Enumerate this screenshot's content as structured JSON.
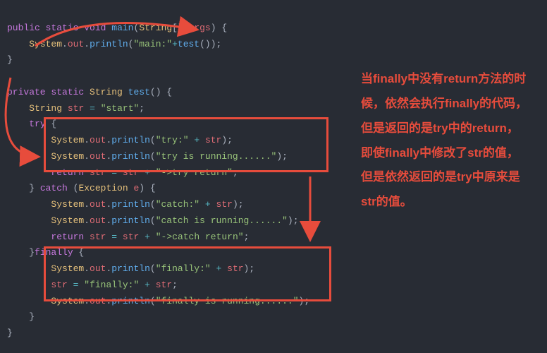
{
  "code": {
    "l1_public": "public",
    "l1_static": "static",
    "l1_void": "void",
    "l1_main": "main",
    "l1_string": "String",
    "l1_args": "args",
    "l2_system": "System",
    "l2_out": "out",
    "l2_println": "println",
    "l2_str": "\"main:\"",
    "l2_test": "test",
    "l5_private": "private",
    "l5_static": "static",
    "l5_string": "String",
    "l5_test": "test",
    "l6_string": "String",
    "l6_str": "str",
    "l6_val": "\"start\"",
    "l7_try": "try",
    "l8_system": "System",
    "l8_out": "out",
    "l8_println": "println",
    "l8_str": "\"try:\"",
    "l8_var": "str",
    "l9_system": "System",
    "l9_out": "out",
    "l9_println": "println",
    "l9_str": "\"try is running......\"",
    "l10_return": "return",
    "l10_var": "str",
    "l10_var2": "str",
    "l10_str": "\"->try return\"",
    "l11_catch": "catch",
    "l11_exc": "Exception",
    "l11_e": "e",
    "l12_system": "System",
    "l12_out": "out",
    "l12_println": "println",
    "l12_str": "\"catch:\"",
    "l12_var": "str",
    "l13_system": "System",
    "l13_out": "out",
    "l13_println": "println",
    "l13_str": "\"catch is running......\"",
    "l14_return": "return",
    "l14_var": "str",
    "l14_var2": "str",
    "l14_str": "\"->catch return\"",
    "l15_finally": "finally",
    "l16_system": "System",
    "l16_out": "out",
    "l16_println": "println",
    "l16_str": "\"finally:\"",
    "l16_var": "str",
    "l17_var": "str",
    "l17_str": "\"finally:\"",
    "l17_var2": "str",
    "l18_system": "System",
    "l18_out": "out",
    "l18_println": "println",
    "l18_str": "\"finally is running......\""
  },
  "annotation": {
    "text": "当finally中没有return方法的时候，依然会执行finally的代码，但是返回的是try中的return，即使finally中修改了str的值，但是依然返回的是try中原来是str的值。"
  },
  "colors": {
    "accent": "#e74c3c",
    "bg": "#282c34"
  }
}
